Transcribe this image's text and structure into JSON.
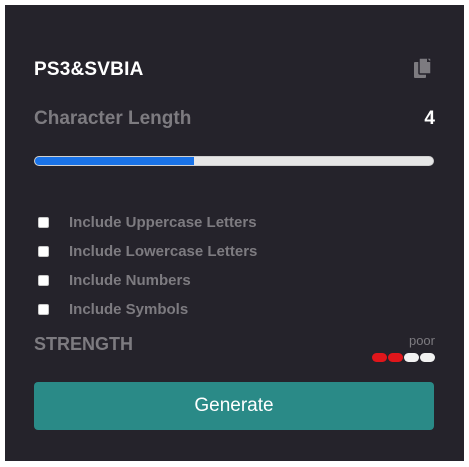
{
  "password": {
    "value": "PS3&SVBIA",
    "copy_icon": "copy-icon"
  },
  "length": {
    "label": "Character Length",
    "value": "4",
    "fill_fraction": 0.4
  },
  "options": [
    {
      "label": "Include Uppercase Letters",
      "checked": false
    },
    {
      "label": "Include Lowercase Letters",
      "checked": false
    },
    {
      "label": "Include Numbers",
      "checked": false
    },
    {
      "label": "Include Symbols",
      "checked": false
    }
  ],
  "strength": {
    "label": "STRENGTH",
    "value": "poor",
    "bars_active": 2,
    "bars_total": 4,
    "active_color": "#e0161b"
  },
  "generate": {
    "label": "Generate",
    "color": "#2a8a87"
  },
  "colors": {
    "background": "#25232b",
    "slider_fill": "#1a73e8"
  }
}
